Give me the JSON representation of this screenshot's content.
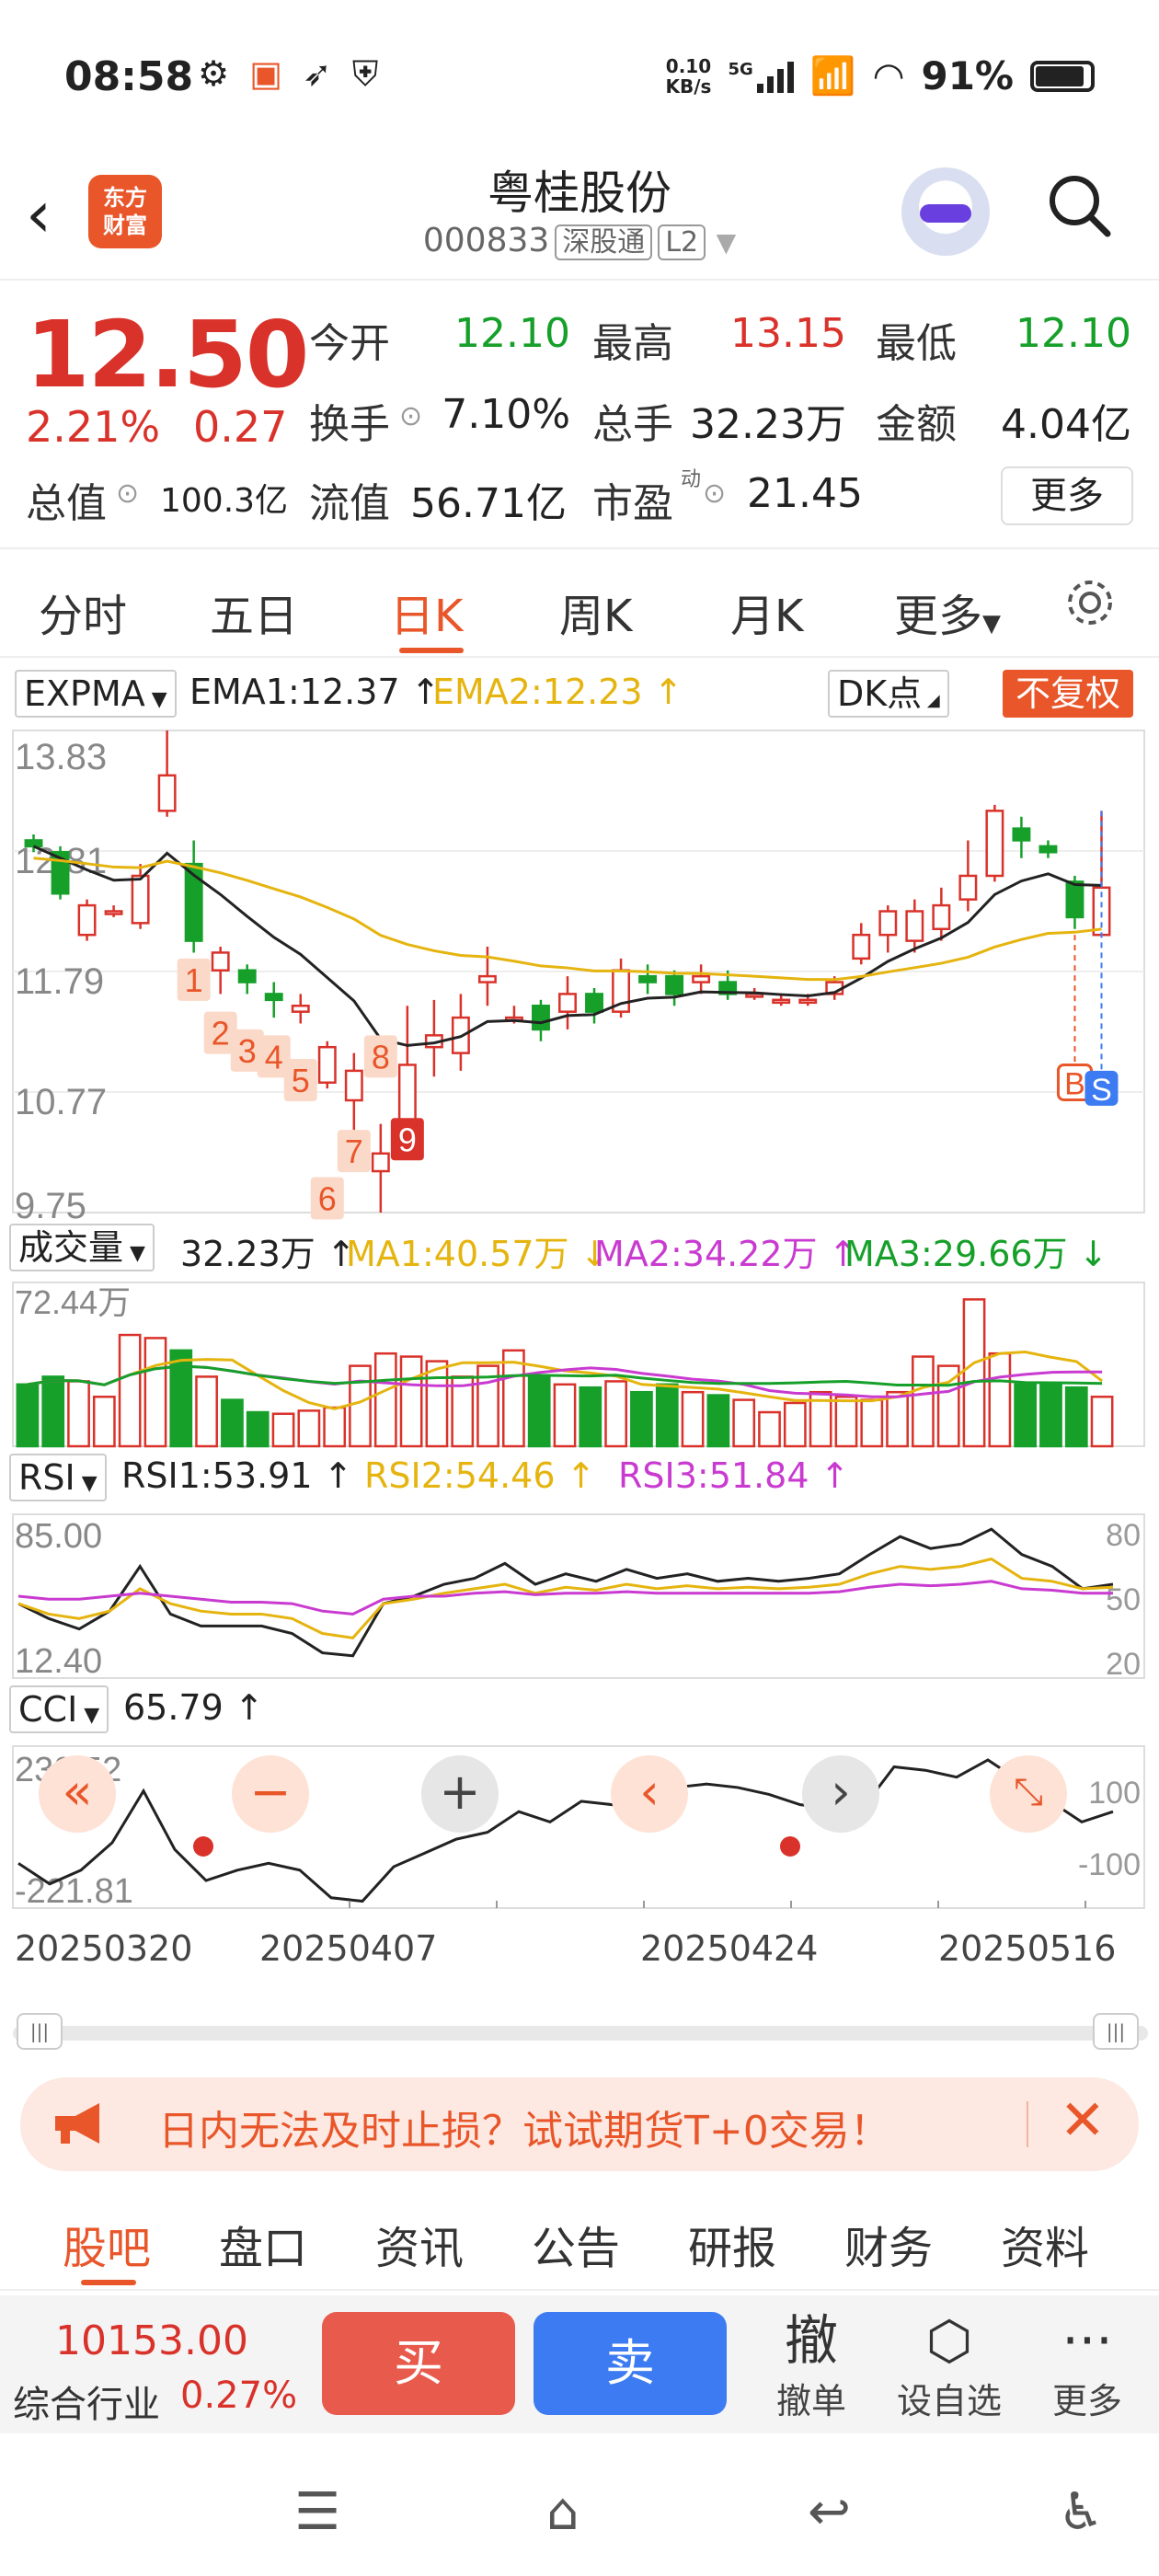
{
  "status": {
    "time": "08:58",
    "speed_top": "0.10",
    "speed_unit": "KB/s",
    "network": "5G",
    "battery_pct": "91%"
  },
  "header": {
    "title": "粤桂股份",
    "code": "000833",
    "market_tag": "深股通",
    "level_tag": "L2",
    "logo_text": "东方\n财富"
  },
  "quote": {
    "price": "12.50",
    "chg_pct": "2.21%",
    "chg_amt": "0.27",
    "open_label": "今开",
    "open": "12.10",
    "high_label": "最高",
    "high": "13.15",
    "low_label": "最低",
    "low": "12.10",
    "turnover_label": "换手",
    "turnover": "7.10%",
    "volume_label": "总手",
    "volume": "32.23万",
    "amount_label": "金额",
    "amount": "4.04亿",
    "mktcap_label": "总值",
    "mktcap": "100.3亿",
    "float_label": "流值",
    "float": "56.71亿",
    "pe_label": "市盈",
    "pe_sup": "动",
    "pe": "21.45",
    "more_label": "更多"
  },
  "ktabs": {
    "items": [
      "分时",
      "五日",
      "日K",
      "周K",
      "月K",
      "更多"
    ],
    "active": "日K"
  },
  "chart_data": [
    {
      "type": "candlestick",
      "indicator": "EXPMA",
      "ema1_label": "EMA1:12.37 ↑",
      "ema2_label": "EMA2:12.23 ↑",
      "dk_label": "DK点",
      "fq_label": "不复权",
      "y_ticks": [
        "13.83",
        "12.81",
        "11.79",
        "10.77",
        "9.75"
      ],
      "ylim": [
        9.75,
        13.83
      ],
      "candles": [
        [
          12.9,
          12.85,
          12.95,
          12.8
        ],
        [
          12.8,
          12.45,
          12.85,
          12.4
        ],
        [
          12.1,
          12.35,
          12.4,
          12.05
        ],
        [
          12.3,
          12.3,
          12.35,
          12.25
        ],
        [
          12.2,
          12.6,
          12.7,
          12.15
        ],
        [
          13.15,
          13.45,
          13.83,
          13.1
        ],
        [
          12.7,
          12.05,
          12.9,
          11.95
        ],
        [
          11.8,
          11.95,
          12.0,
          11.6
        ],
        [
          11.8,
          11.7,
          11.85,
          11.6
        ],
        [
          11.6,
          11.55,
          11.7,
          11.4
        ],
        [
          11.45,
          11.5,
          11.6,
          11.35
        ],
        [
          10.85,
          11.15,
          11.2,
          10.8
        ],
        [
          10.7,
          10.95,
          11.1,
          10.45
        ],
        [
          10.1,
          10.25,
          10.5,
          9.75
        ],
        [
          10.5,
          11.0,
          11.5,
          10.3
        ],
        [
          11.15,
          11.25,
          11.55,
          10.9
        ],
        [
          11.1,
          11.4,
          11.6,
          10.95
        ],
        [
          11.7,
          11.75,
          12.0,
          11.5
        ],
        [
          11.4,
          11.4,
          11.5,
          11.35
        ],
        [
          11.5,
          11.3,
          11.55,
          11.2
        ],
        [
          11.45,
          11.6,
          11.75,
          11.3
        ],
        [
          11.6,
          11.45,
          11.65,
          11.35
        ],
        [
          11.45,
          11.8,
          11.9,
          11.4
        ],
        [
          11.75,
          11.7,
          11.85,
          11.6
        ],
        [
          11.75,
          11.6,
          11.8,
          11.5
        ],
        [
          11.7,
          11.75,
          11.85,
          11.6
        ],
        [
          11.7,
          11.6,
          11.8,
          11.55
        ],
        [
          11.6,
          11.6,
          11.65,
          11.55
        ],
        [
          11.55,
          11.55,
          11.6,
          11.5
        ],
        [
          11.55,
          11.55,
          11.6,
          11.5
        ],
        [
          11.6,
          11.7,
          11.75,
          11.55
        ],
        [
          11.9,
          12.1,
          12.2,
          11.85
        ],
        [
          12.1,
          12.3,
          12.35,
          11.95
        ],
        [
          12.05,
          12.3,
          12.4,
          11.95
        ],
        [
          12.15,
          12.35,
          12.5,
          12.05
        ],
        [
          12.4,
          12.6,
          12.9,
          12.3
        ],
        [
          12.6,
          13.15,
          13.2,
          12.55
        ],
        [
          13.0,
          12.9,
          13.1,
          12.75
        ],
        [
          12.85,
          12.8,
          12.9,
          12.75
        ],
        [
          12.55,
          12.25,
          12.6,
          12.15
        ],
        [
          12.1,
          12.5,
          13.15,
          12.1
        ]
      ],
      "markers": [
        "1",
        "2",
        "3",
        "4",
        "5",
        "6",
        "7",
        "8",
        "9"
      ],
      "bs": [
        "B",
        "S"
      ]
    },
    {
      "type": "bar",
      "indicator": "成交量",
      "vol_label": "32.23万 ↑",
      "ma1_label": "MA1:40.57万 ↓",
      "ma2_label": "MA2:34.22万 ↑",
      "ma3_label": "MA3:29.66万 ↓",
      "y_tick": "72.44万",
      "values": [
        40,
        45,
        42,
        32,
        72,
        70,
        62,
        45,
        30,
        22,
        21,
        23,
        25,
        52,
        60,
        58,
        55,
        45,
        52,
        62,
        45,
        40,
        38,
        42,
        35,
        40,
        35,
        33,
        30,
        22,
        28,
        35,
        32,
        30,
        35,
        58,
        52,
        95,
        60,
        40,
        41,
        38,
        32
      ]
    },
    {
      "type": "line",
      "indicator": "RSI",
      "rsi1_label": "RSI1:53.91 ↑",
      "rsi2_label": "RSI2:54.46 ↑",
      "rsi3_label": "RSI3:51.84 ↑",
      "y_ticks_left": [
        "85.00",
        "12.40"
      ],
      "y_ticks_right": [
        "80",
        "50",
        "20"
      ],
      "rsi1": [
        45,
        35,
        28,
        40,
        70,
        38,
        30,
        30,
        30,
        25,
        12,
        10,
        45,
        50,
        58,
        62,
        72,
        58,
        65,
        60,
        68,
        62,
        65,
        60,
        62,
        60,
        62,
        65,
        78,
        90,
        82,
        85,
        95,
        78,
        70,
        55,
        58
      ],
      "rsi2": [
        45,
        38,
        35,
        40,
        55,
        45,
        40,
        38,
        38,
        35,
        25,
        22,
        45,
        48,
        52,
        55,
        58,
        52,
        56,
        54,
        58,
        55,
        57,
        55,
        56,
        55,
        56,
        58,
        65,
        70,
        68,
        70,
        75,
        62,
        60,
        55,
        56
      ],
      "rsi3": [
        50,
        48,
        48,
        50,
        52,
        50,
        48,
        46,
        46,
        45,
        40,
        38,
        48,
        50,
        50,
        52,
        53,
        51,
        52,
        52,
        53,
        52,
        52,
        52,
        52,
        52,
        52,
        53,
        56,
        58,
        57,
        58,
        60,
        55,
        54,
        52,
        52
      ]
    },
    {
      "type": "line",
      "indicator": "CCI",
      "cci_label": "65.79 ↑",
      "y_ticks_left": [
        "230.52",
        "-221.81"
      ],
      "y_ticks_right": [
        "100",
        "-100"
      ],
      "values": [
        -100,
        -160,
        -120,
        -40,
        110,
        -60,
        -150,
        -120,
        -100,
        -120,
        -200,
        -210,
        -110,
        -70,
        -30,
        -10,
        50,
        20,
        80,
        70,
        110,
        120,
        130,
        120,
        100,
        70,
        60,
        60,
        180,
        170,
        150,
        200,
        140,
        80,
        20,
        50
      ]
    }
  ],
  "x_dates": [
    "20250320",
    "20250407",
    "20250424",
    "20250516"
  ],
  "banner": {
    "text": "日内无法及时止损？试试期货T+0交易！"
  },
  "btabs": {
    "items": [
      "股吧",
      "盘口",
      "资讯",
      "公告",
      "研报",
      "财务",
      "资料"
    ],
    "active": "股吧"
  },
  "trade": {
    "index_value": "10153.00",
    "index_label": "综合行业",
    "index_pct": "0.27%",
    "buy": "买",
    "sell": "卖",
    "cancel_icon": "撤",
    "cancel": "撤单",
    "watch": "设自选",
    "more": "更多"
  },
  "colors": {
    "red": "#d9322a",
    "green": "#16a02a",
    "accent": "#e8562a",
    "blue": "#3d7bf2"
  }
}
